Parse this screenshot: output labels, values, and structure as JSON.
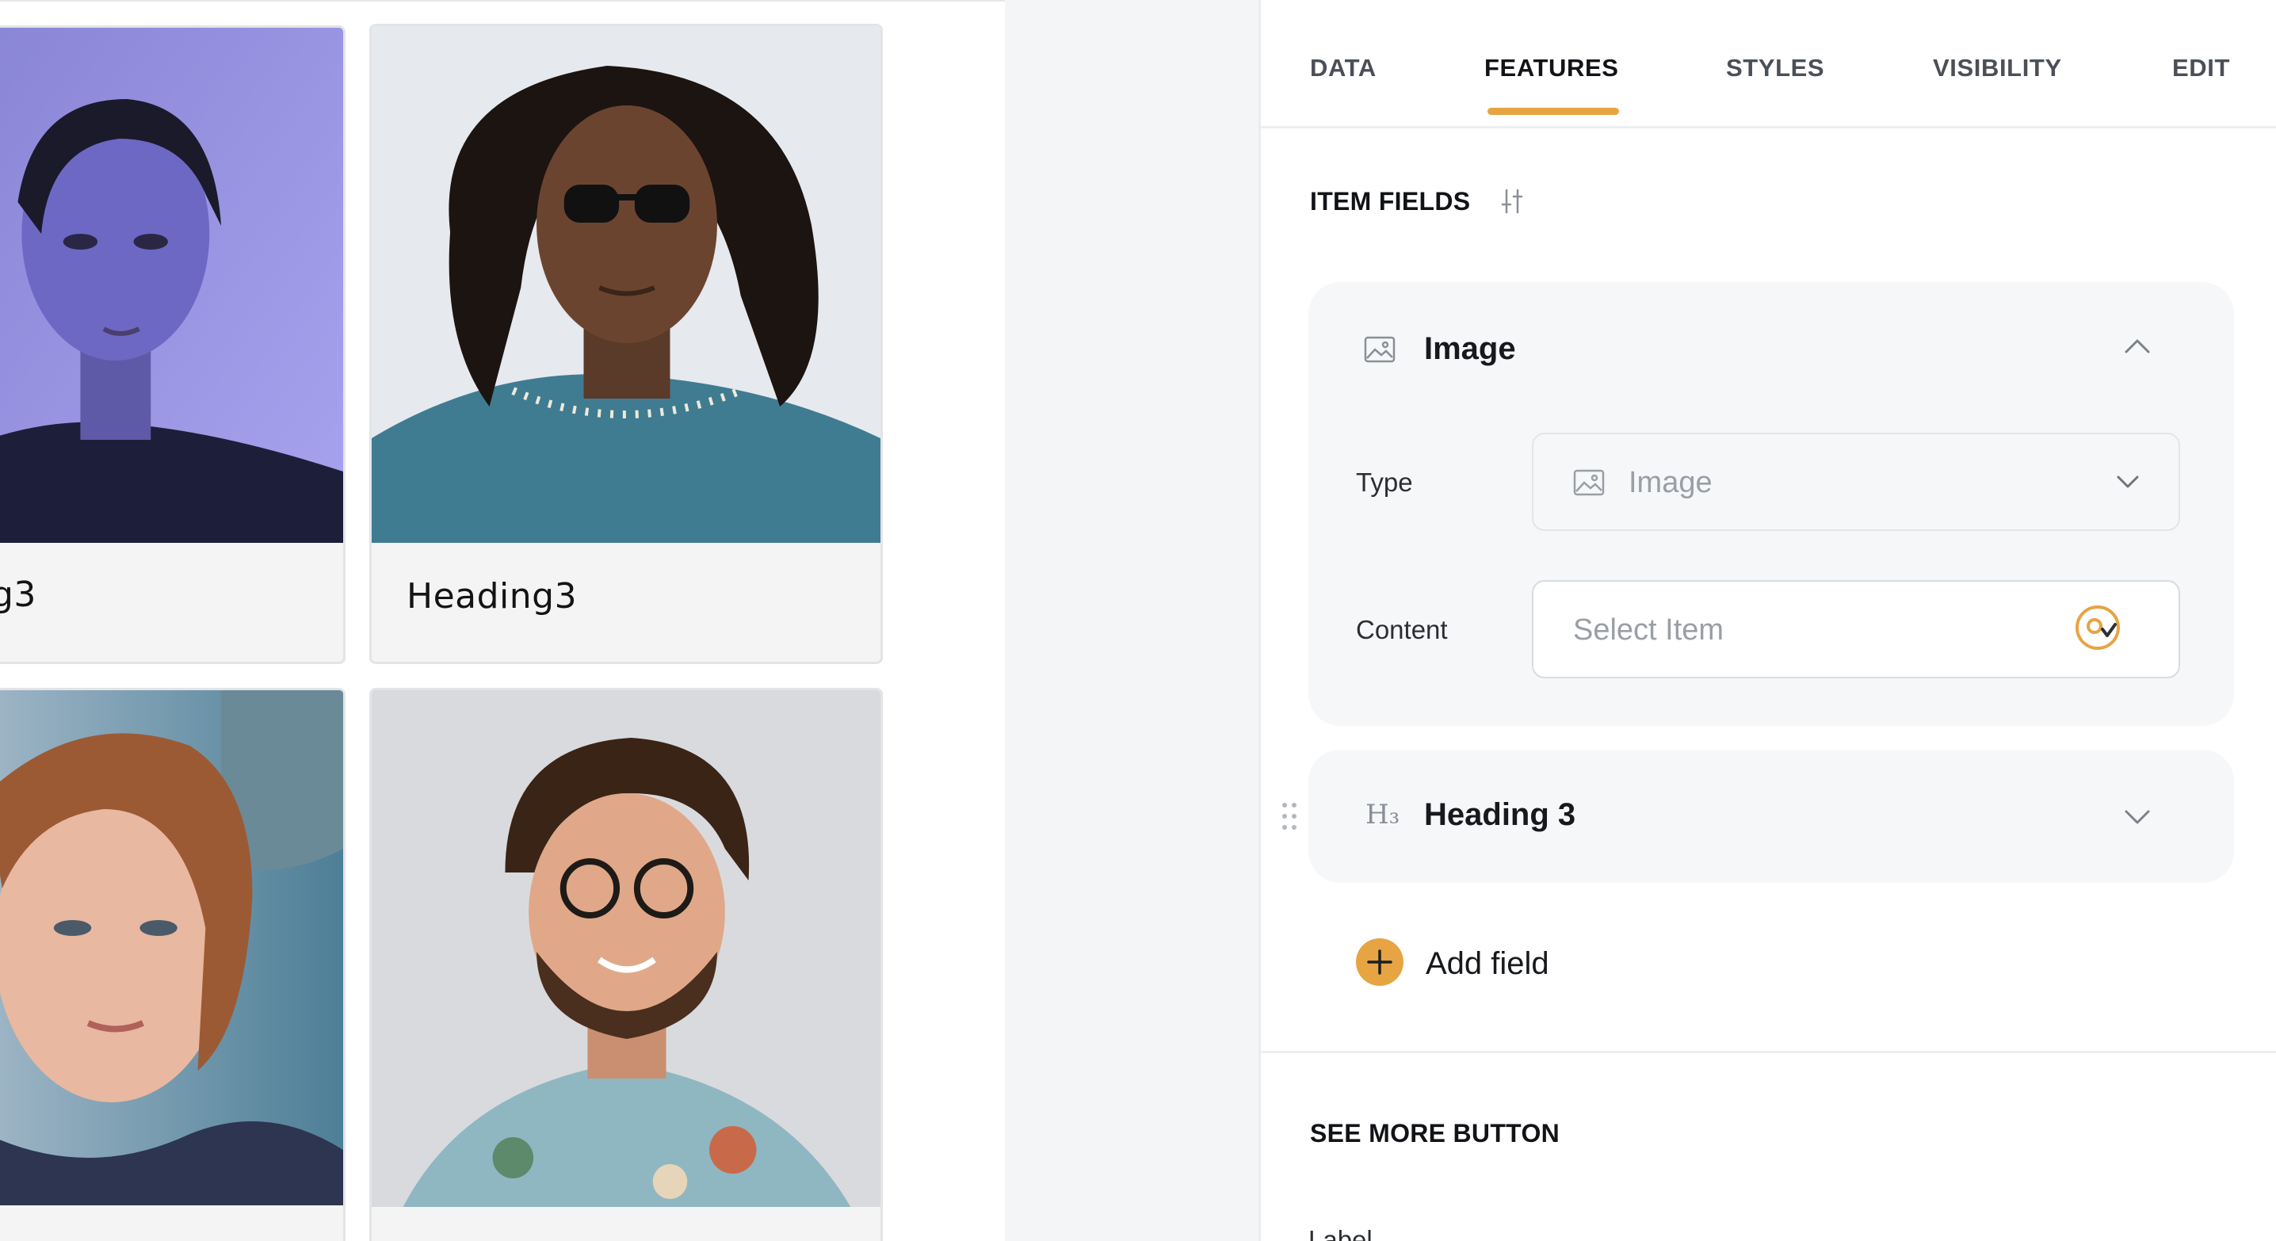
{
  "canvas": {
    "cards": [
      {
        "caption": "g3",
        "alt": "woman-portrait-blue-light"
      },
      {
        "caption": "Heading3",
        "alt": "man-curly-hair-sunglasses"
      },
      {
        "caption": "",
        "alt": "red-haired-young-woman"
      },
      {
        "caption": "",
        "alt": "smiling-man-glasses"
      }
    ]
  },
  "panel": {
    "tabs": [
      {
        "label": "DATA",
        "active": false
      },
      {
        "label": "FEATURES",
        "active": true
      },
      {
        "label": "STYLES",
        "active": false
      },
      {
        "label": "VISIBILITY",
        "active": false
      },
      {
        "label": "EDIT",
        "active": false
      }
    ],
    "item_fields": {
      "title": "ITEM FIELDS",
      "settings_icon": "sliders-icon",
      "fields": [
        {
          "icon": "image-icon",
          "title": "Image",
          "expanded": true,
          "type_label": "Type",
          "type_value": "Image",
          "type_icon": "image-icon",
          "content_label": "Content",
          "content_placeholder": "Select Item",
          "content_icon": "select-item-icon"
        },
        {
          "icon": "heading-3-icon",
          "icon_text": "H₃",
          "title": "Heading 3",
          "expanded": false
        }
      ],
      "add_field_label": "Add field"
    },
    "see_more": {
      "title": "SEE MORE BUTTON",
      "next_label": "Label"
    }
  },
  "colors": {
    "accent": "#e6a443",
    "panel_bg": "#ffffff",
    "group_bg": "#f6f7f9",
    "gutter_bg": "#f4f5f7"
  }
}
